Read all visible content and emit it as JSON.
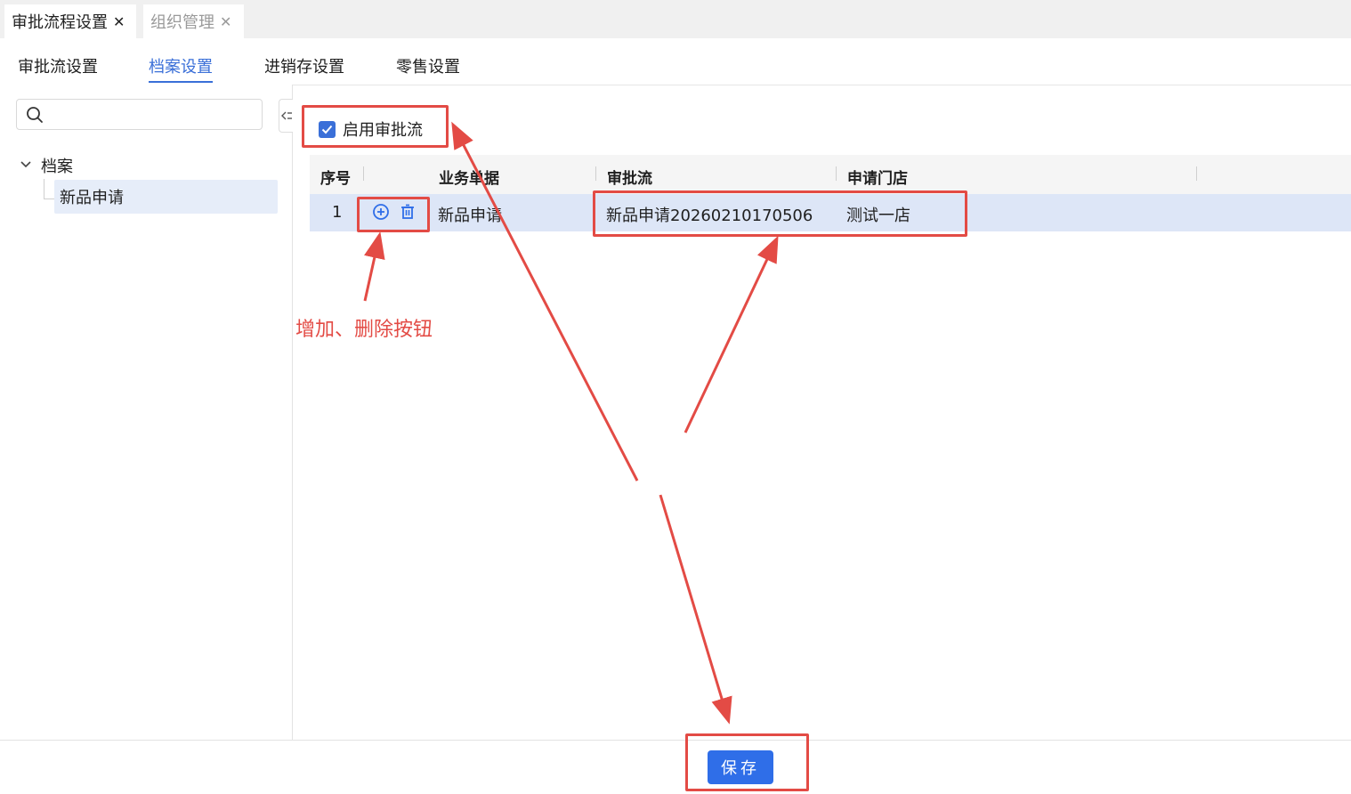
{
  "window_tabs": [
    {
      "label": "审批流程设置",
      "close": "✕"
    },
    {
      "label": "组织管理",
      "close": "✕"
    }
  ],
  "sub_tabs": [
    {
      "label": "审批流设置"
    },
    {
      "label": "档案设置"
    },
    {
      "label": "进销存设置"
    },
    {
      "label": "零售设置"
    }
  ],
  "sidebar": {
    "search_placeholder": "",
    "tree_root": "档案",
    "tree_leaf": "新品申请"
  },
  "enable_checkbox": {
    "label": "启用审批流",
    "checked": true
  },
  "table": {
    "headers": [
      "序号",
      "业务单据",
      "审批流",
      "申请门店"
    ],
    "rows": [
      {
        "index": "1",
        "doc": "新品申请",
        "flow": "新品申请20260210170506",
        "store": "测试一店"
      }
    ]
  },
  "annotation": {
    "note": "增加、删除按钮",
    "color": "#e34b45"
  },
  "footer": {
    "save_label": "保存"
  },
  "colors": {
    "accent": "#3a6fd8",
    "button": "#2f6ee8",
    "row_highlight": "#dde6f7"
  }
}
